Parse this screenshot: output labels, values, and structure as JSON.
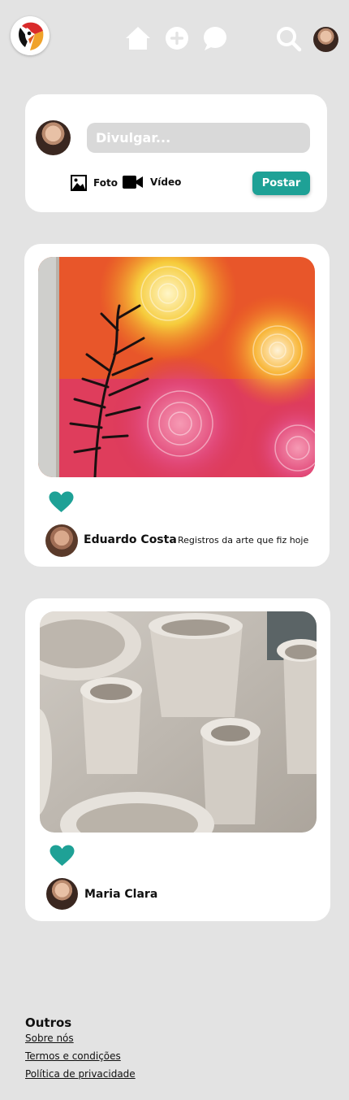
{
  "nav": {
    "logo_icon": "parrot-logo-icon",
    "icons": [
      "home-icon",
      "add-icon",
      "chat-bubble-icon",
      "search-icon"
    ],
    "profile_avatar": "user-avatar"
  },
  "composer": {
    "placeholder": "Divulgar...",
    "photo_label": "Foto",
    "video_label": "Vídeo",
    "post_button": "Postar"
  },
  "posts": [
    {
      "image": "painting-sunset-swirls",
      "liked": true,
      "author": "Eduardo Costa",
      "caption": "Registros da arte que fiz hoje"
    },
    {
      "image": "ceramic-pots",
      "liked": true,
      "author": "Maria Clara",
      "caption": ""
    }
  ],
  "footer": {
    "title": "Outros",
    "links": [
      "Sobre nós",
      "Termos e condições",
      "Política de privacidade"
    ]
  },
  "colors": {
    "accent": "#1ea196",
    "background": "#e3e3e3",
    "input_bg": "#d9d9d9"
  }
}
